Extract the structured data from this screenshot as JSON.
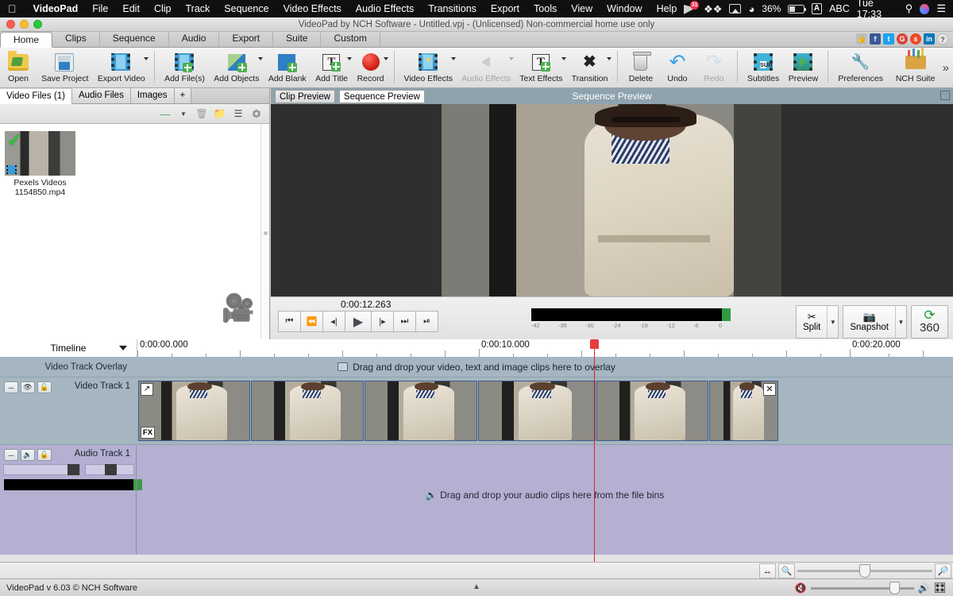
{
  "menubar": {
    "apple_icon": "apple-icon",
    "items": [
      "VideoPad",
      "File",
      "Edit",
      "Clip",
      "Track",
      "Sequence",
      "Video Effects",
      "Audio Effects",
      "Transitions",
      "Export",
      "Tools",
      "View",
      "Window",
      "Help"
    ],
    "status": {
      "notification_badge": "31",
      "battery_percent": "36%",
      "input_source": "ABC",
      "clock": "Tue 17:33",
      "icons": [
        "flag-icon",
        "dropbox-icon",
        "airplay-icon",
        "wifi-icon",
        "battery-icon",
        "keyboard-input-icon",
        "spotlight-search-icon",
        "siri-icon",
        "notification-center-icon"
      ]
    }
  },
  "window": {
    "title": "VideoPad by NCH Software - Untitled.vpj - (Unlicensed) Non-commercial home use only",
    "traffic_lights": [
      "close",
      "minimize",
      "zoom"
    ]
  },
  "ribbon_tabs": {
    "items": [
      "Home",
      "Clips",
      "Sequence",
      "Audio",
      "Export",
      "Suite",
      "Custom"
    ],
    "active": "Home",
    "social": [
      "thumbs-up-icon",
      "facebook-icon",
      "twitter-icon",
      "google-plus-icon",
      "stumbleupon-icon",
      "linkedin-icon",
      "help-icon"
    ]
  },
  "toolbar": {
    "overflow_label": "»",
    "groups": [
      {
        "buttons": [
          {
            "label": "Open",
            "icon": "open-folder-icon",
            "dropdown": false,
            "disabled": false
          },
          {
            "label": "Save Project",
            "icon": "floppy-disk-icon",
            "dropdown": false,
            "disabled": false
          },
          {
            "label": "Export Video",
            "icon": "export-film-icon",
            "dropdown": true,
            "disabled": false
          }
        ]
      },
      {
        "buttons": [
          {
            "label": "Add File(s)",
            "icon": "add-file-icon",
            "dropdown": false,
            "disabled": false
          },
          {
            "label": "Add Objects",
            "icon": "add-objects-icon",
            "dropdown": true,
            "disabled": false
          },
          {
            "label": "Add Blank",
            "icon": "add-blank-icon",
            "dropdown": false,
            "disabled": false
          },
          {
            "label": "Add Title",
            "icon": "add-title-icon",
            "dropdown": true,
            "disabled": false
          },
          {
            "label": "Record",
            "icon": "record-icon",
            "dropdown": true,
            "disabled": false
          }
        ]
      },
      {
        "buttons": [
          {
            "label": "Video Effects",
            "icon": "video-effects-icon",
            "dropdown": true,
            "disabled": false
          },
          {
            "label": "Audio Effects",
            "icon": "audio-effects-icon",
            "dropdown": true,
            "disabled": true
          },
          {
            "label": "Text Effects",
            "icon": "text-effects-icon",
            "dropdown": true,
            "disabled": false
          },
          {
            "label": "Transition",
            "icon": "transition-icon",
            "dropdown": true,
            "disabled": false
          }
        ]
      },
      {
        "buttons": [
          {
            "label": "Delete",
            "icon": "trash-icon",
            "dropdown": false,
            "disabled": false
          },
          {
            "label": "Undo",
            "icon": "undo-arrow-icon",
            "dropdown": false,
            "disabled": false
          },
          {
            "label": "Redo",
            "icon": "redo-arrow-icon",
            "dropdown": false,
            "disabled": true
          }
        ]
      },
      {
        "buttons": [
          {
            "label": "Subtitles",
            "icon": "subtitles-icon",
            "dropdown": false,
            "disabled": false
          },
          {
            "label": "Preview",
            "icon": "preview-film-icon",
            "dropdown": false,
            "disabled": false
          }
        ]
      },
      {
        "buttons": [
          {
            "label": "Preferences",
            "icon": "wrench-screwdriver-icon",
            "dropdown": false,
            "disabled": false
          },
          {
            "label": "NCH Suite",
            "icon": "nch-suite-icon",
            "dropdown": false,
            "disabled": false
          }
        ]
      }
    ]
  },
  "bin": {
    "tabs": [
      "Video Files (1)",
      "Audio Files",
      "Images"
    ],
    "active_tab": "Video Files (1)",
    "add_tab_label": "+",
    "tools": [
      "link-icon",
      "dropdown-caret-icon",
      "delete-icon",
      "add-folder-icon",
      "list-view-icon",
      "detach-icon"
    ],
    "files": [
      {
        "name_line1": "Pexels Videos",
        "name_line2": "1154850.mp4",
        "selected": true,
        "type": "video"
      }
    ],
    "watermark_icon": "movie-camera-icon"
  },
  "preview": {
    "tabs": [
      "Clip Preview",
      "Sequence Preview"
    ],
    "active_tab": "Sequence Preview",
    "title": "Sequence Preview",
    "expand_icon": "expand-icon",
    "timecode": "0:00:12.263",
    "transport_buttons": [
      {
        "icon": "skip-to-start-icon",
        "name": "go-to-start"
      },
      {
        "icon": "prev-frame-marker-icon",
        "name": "previous-marker"
      },
      {
        "icon": "step-back-icon",
        "name": "step-back"
      },
      {
        "icon": "play-icon",
        "name": "play"
      },
      {
        "icon": "step-forward-icon",
        "name": "step-forward"
      },
      {
        "icon": "next-marker-icon",
        "name": "next-marker"
      },
      {
        "icon": "skip-to-end-icon",
        "name": "go-to-end"
      }
    ],
    "meter_ticks": [
      "-42",
      "-36",
      "-30",
      "-24",
      "-18",
      "-12",
      "-6",
      "0"
    ],
    "actions": [
      {
        "label": "Split",
        "icon": "scissors-icon",
        "dropdown": true
      },
      {
        "label": "Snapshot",
        "icon": "camera-icon",
        "dropdown": true
      },
      {
        "label": "360",
        "icon": "rotate-360-icon",
        "dropdown": false
      }
    ]
  },
  "timeline": {
    "mode_label": "Timeline",
    "ruler_labels": [
      "0:00:00.000",
      "0:00:10.000",
      "0:00:20.000"
    ],
    "playhead_time": "0:00:12.263",
    "overlay_track": {
      "label": "Video Track Overlay",
      "hint": "Drag and drop your video, text and image clips here to overlay",
      "hint_icon": "image-placeholder-icon"
    },
    "video_track": {
      "label": "Video Track 1",
      "buttons": [
        "collapse-icon",
        "eye-visibility-icon",
        "lock-icon"
      ],
      "clip_badges": {
        "top_left": "↗",
        "bottom_left": "FX",
        "top_right": "✕"
      },
      "clips": 6
    },
    "audio_track": {
      "label": "Audio Track 1",
      "buttons": [
        "collapse-icon",
        "speaker-icon",
        "lock-icon"
      ],
      "hint": "Drag and drop your audio clips here from the file bins",
      "hint_icon": "speaker-icon"
    }
  },
  "bottom": {
    "zoom_controls": [
      "fit-width-icon",
      "zoom-out-icon",
      "zoom-in-icon"
    ],
    "status_text": "VideoPad v 6.03 © NCH Software",
    "volume_icons": [
      "mute-icon",
      "volume-icon",
      "audio-mixer-icon"
    ],
    "expand_caret": "▲"
  },
  "colors": {
    "accent_blue": "#2f7fc4",
    "track_video_bg": "#a5b6c1",
    "track_audio_bg": "#b5b0d2",
    "playhead_red": "#e02020",
    "meter_green": "#2e9c43"
  }
}
